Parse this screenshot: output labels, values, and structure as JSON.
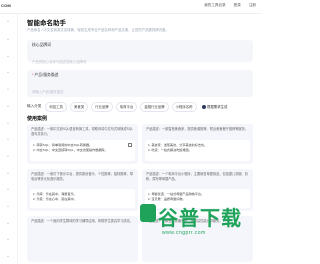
{
  "topbar": {
    "logo_text": "COM",
    "nav": [
      "我的工具目录",
      "登录",
      "注册"
    ]
  },
  "page": {
    "title": "智能命名助手",
    "subtitle": "产品命名 / 中文名到英文名转换，轻松生成专业产品名称和产品文案，让您的产品更具辨识度。"
  },
  "form": {
    "fields": [
      {
        "label": "核心品牌词",
        "required": true,
        "placeholder": "产品的核心名称与描述或核心品牌词"
      },
      {
        "label": "产品/服务描述",
        "required": true,
        "placeholder": "请输入产品/服务描述"
      }
    ]
  },
  "style_tags": {
    "title": "输入分类",
    "items": [
      "科技工具",
      "美食类",
      "行业品牌",
      "电商平台",
      "金融行业品牌",
      "小程序名称"
    ],
    "toggle_label": "根据需求生成"
  },
  "cases": {
    "title": "使用案例",
    "items": [
      {
        "top": "产品描述：一款中文到SQL语言转换工具，帮助你将中文句式转换成SQL语句并执行。",
        "tag": "产品描述",
        "result": "1. 转转SQL：简单易用的中文SQL转换器。\n2. 中文SQL：中文直接转SQL，中文也能操作数据库。"
      },
      {
        "top": "产品描述：一款智慧美食家，提供食谱推荐、附近美食餐厅推荐等服务。",
        "tag": "产品描述",
        "result": "1. 美食家：发现美食、分享美食的好去处。\n2. 吃货：一站式解决吃饭难题。"
      },
      {
        "top": "产品描述：一款灯下音乐平台，提供原创音乐、个性推荐，独特推荐、带电台等多元化音乐服务。",
        "tag": "产品描述",
        "result": "1. 乐库：乐在其中，海量音乐。\n2. 乐思：乐在心中，思在其中。"
      },
      {
        "top": "产品描述：一个电商平台小程序，主要销售母婴用品，包括婴儿衣服、奶粉、尿布等母婴产品。",
        "tag": "产品描述",
        "result": "1. 母婴优选：一站式母婴产品购物平台。\n2. 宝贝屋：品质母婴好物。"
      },
      {
        "top": "产品描述：一个面向学生群体的学习辅导应用，帮助学生提高学习成绩。",
        "tag": "产品描述",
        "result": ""
      },
      {
        "top": "产品描述：一款云服务器产品，提供高性能计算服务。",
        "tag": "产品描述",
        "result": ""
      }
    ]
  },
  "watermark": {
    "text": "谷普下载",
    "sub": "www.cngprr.com"
  }
}
